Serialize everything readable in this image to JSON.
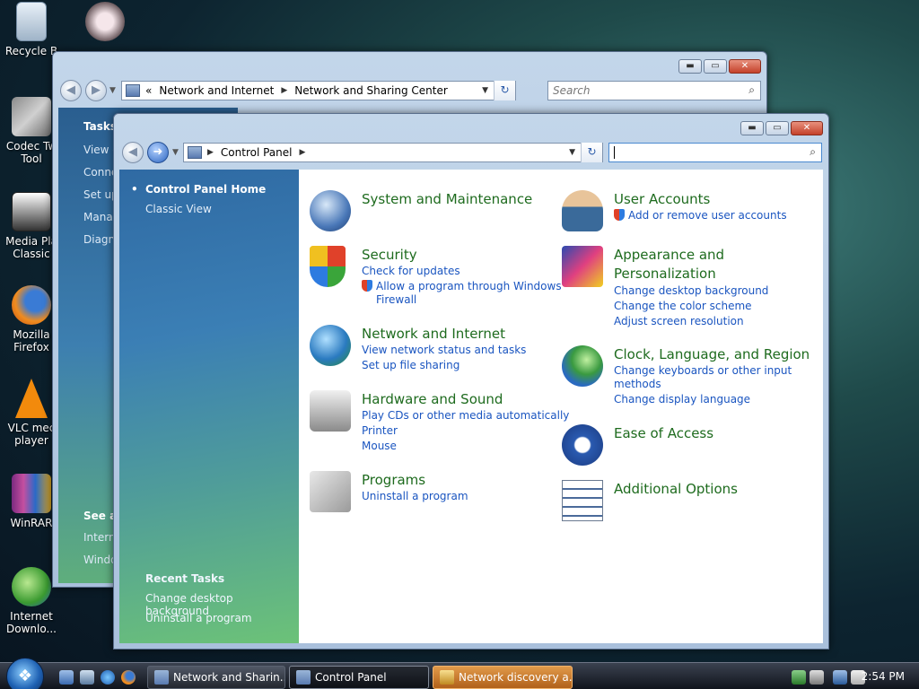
{
  "desktop": {
    "icons": [
      {
        "label": "Recycle Bin",
        "shown_label": "Recycle B",
        "icon": "recycle-bin-icon"
      },
      {
        "label": "Codec Tweak Tool",
        "shown_label": "Codec Tw\nTool",
        "icon": "tools-icon"
      },
      {
        "label": "Media Player Classic",
        "shown_label": "Media Pla\nClassic",
        "icon": "media-player-icon"
      },
      {
        "label": "Mozilla Firefox",
        "shown_label": "Mozilla\nFirefox",
        "icon": "firefox-icon"
      },
      {
        "label": "VLC media player",
        "shown_label": "VLC mec\nplayer",
        "icon": "vlc-icon"
      },
      {
        "label": "WinRAR",
        "shown_label": "WinRAR",
        "icon": "winrar-icon"
      },
      {
        "label": "Internet Download Manager",
        "shown_label": "Internet\nDownlo...",
        "icon": "idm-icon"
      }
    ]
  },
  "back_window": {
    "address": {
      "prefix": "«",
      "crumb1": "Network and Internet",
      "crumb2": "Network and Sharing Center"
    },
    "search_placeholder": "Search",
    "tasks_heading": "Tasks",
    "task_links": [
      "View c",
      "Conne",
      "Set up",
      "Manag",
      "Diagno"
    ],
    "see_also_heading": "See al",
    "see_also_links": [
      "Intern",
      "Windo"
    ]
  },
  "front_window": {
    "address": {
      "crumb1": "Control Panel"
    },
    "search_value": "",
    "left_panel": {
      "home": "Control Panel Home",
      "classic": "Classic View",
      "recent_heading": "Recent Tasks",
      "recent": [
        "Change desktop background",
        "Uninstall a program"
      ]
    },
    "categories_left": [
      {
        "title": "System and Maintenance",
        "links": [],
        "icon": "system-maintenance-icon"
      },
      {
        "title": "Security",
        "links": [
          "Check for updates",
          "Allow a program through Windows",
          "Firewall"
        ],
        "icon": "security-shield-icon"
      },
      {
        "title": "Network and Internet",
        "links": [
          "View network status and tasks",
          "Set up file sharing"
        ],
        "icon": "network-internet-icon"
      },
      {
        "title": "Hardware and Sound",
        "links": [
          "Play CDs or other media automatically",
          "Printer",
          "Mouse"
        ],
        "icon": "hardware-sound-icon"
      },
      {
        "title": "Programs",
        "links": [
          "Uninstall a program"
        ],
        "icon": "programs-icon"
      }
    ],
    "categories_right": [
      {
        "title": "User Accounts",
        "links": [
          "Add or remove user accounts"
        ],
        "icon": "user-accounts-icon"
      },
      {
        "title": "Appearance and",
        "title2": "Personalization",
        "links": [
          "Change desktop background",
          "Change the color scheme",
          "Adjust screen resolution"
        ],
        "icon": "appearance-icon"
      },
      {
        "title": "Clock, Language, and Region",
        "links": [
          "Change keyboards or other input",
          "methods",
          "Change display language"
        ],
        "icon": "clock-language-icon"
      },
      {
        "title": "Ease of Access",
        "links": [],
        "icon": "ease-of-access-icon"
      },
      {
        "title": "Additional Options",
        "links": [],
        "icon": "additional-options-icon"
      }
    ]
  },
  "taskbar": {
    "start_glyph": "❖",
    "buttons": [
      {
        "label": "Network and Sharin...",
        "state": "normal"
      },
      {
        "label": "Control Panel",
        "state": "active"
      },
      {
        "label": "Network discovery a...",
        "state": "flash"
      }
    ],
    "clock": "2:54 PM"
  }
}
